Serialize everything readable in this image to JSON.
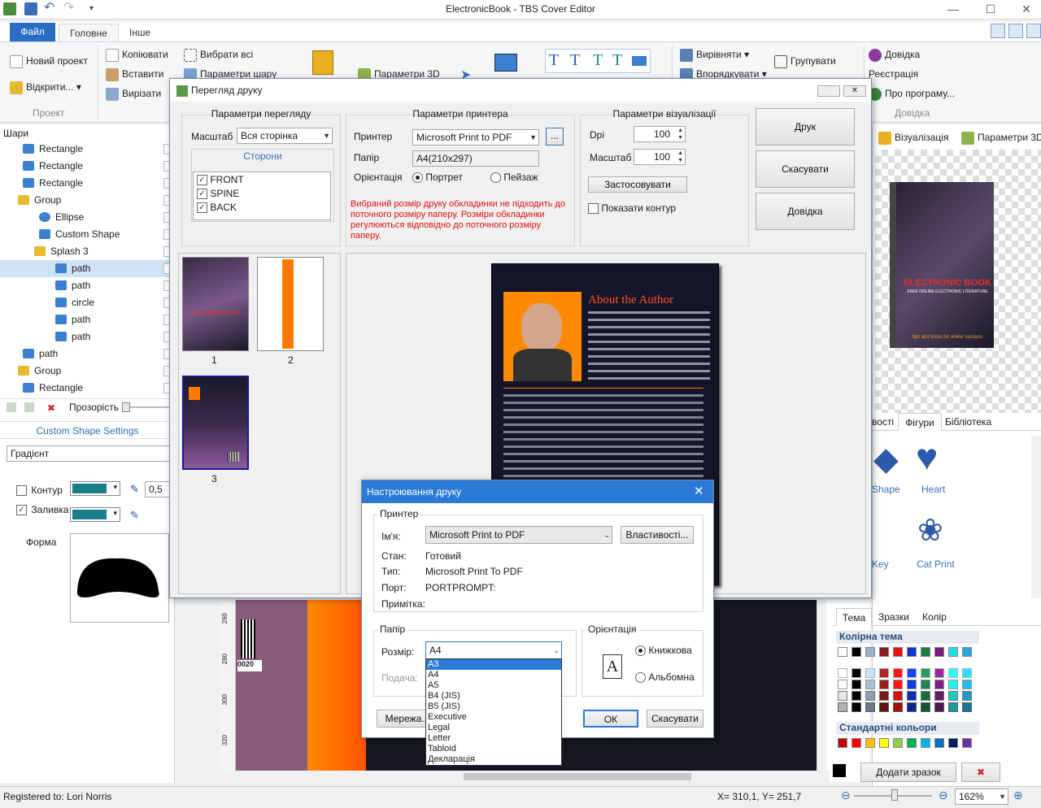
{
  "app": {
    "title": "ElectronicBook - TBS Cover Editor"
  },
  "ribbon": {
    "file_tab": "Файл",
    "tabs": [
      "Головне",
      "Інше"
    ],
    "project": {
      "new": "Новий проект",
      "open": "Відкрити...",
      "label": "Проект"
    },
    "clipboard": {
      "copy": "Копіювати",
      "paste": "Вставити",
      "cut": "Вирізати"
    },
    "select_all": "Вибрати всі",
    "layer_params": "Параметри шару",
    "params3d": "Параметри 3D",
    "arrange": {
      "align": "Вирівняти",
      "order": "Впорядкувати",
      "group": "Групувати"
    },
    "help": {
      "help": "Довідка",
      "register": "Реєстрація",
      "about": "Про програму...",
      "label": "Довідка"
    }
  },
  "layers": {
    "header": "Шари",
    "items": [
      {
        "label": "Rectangle",
        "icon": "rectangle-icon"
      },
      {
        "label": "Rectangle",
        "icon": "rectangle-icon"
      },
      {
        "label": "Rectangle",
        "icon": "rectangle-icon"
      },
      {
        "label": "Group",
        "icon": "folder-icon"
      },
      {
        "label": "Ellipse",
        "icon": "ellipse-icon"
      },
      {
        "label": "Custom Shape",
        "icon": "custom-shape-icon"
      },
      {
        "label": "Splash 3",
        "icon": "folder-icon"
      },
      {
        "label": "path",
        "icon": "path-icon"
      },
      {
        "label": "path",
        "icon": "path-icon"
      },
      {
        "label": "circle",
        "icon": "path-icon"
      },
      {
        "label": "path",
        "icon": "path-icon"
      },
      {
        "label": "path",
        "icon": "path-icon"
      },
      {
        "label": "path",
        "icon": "path-icon"
      },
      {
        "label": "Group",
        "icon": "folder-icon"
      },
      {
        "label": "Rectangle",
        "icon": "rectangle-icon"
      }
    ],
    "transparency_label": "Прозорість",
    "settings_title": "Custom Shape Settings",
    "fill_type": "Градієнт",
    "outline_label": "Контур",
    "outline_width": "0,5",
    "fill_label": "Заливка",
    "shape_label": "Форма"
  },
  "print_preview": {
    "title": "Перегляд друку",
    "view_params": {
      "legend": "Параметри перегляду",
      "scale_label": "Масштаб",
      "scale_value": "Вся сторінка",
      "sides_label": "Сторони",
      "sides": [
        "FRONT",
        "SPINE",
        "BACK"
      ]
    },
    "printer_params": {
      "legend": "Параметри принтера",
      "printer_label": "Принтер",
      "printer_value": "Microsoft Print to PDF",
      "browse": "...",
      "paper_label": "Папір",
      "paper_value": "A4(210x297)",
      "orientation_label": "Орієнтація",
      "portrait": "Портрет",
      "landscape": "Пейзаж",
      "warning": "Вибраний розмір друку обкладинки не підходить до поточного розміру паперу. Розміри обкладинки регулюються відповідно до поточного розміру паперу."
    },
    "visual_params": {
      "legend": "Параметри візуалізації",
      "dpi_label": "Dpi",
      "dpi_value": "100",
      "scale_label": "Масштаб",
      "scale_value": "100",
      "apply": "Застосовувати",
      "show_outline": "Показати контур"
    },
    "buttons": {
      "print": "Друк",
      "cancel": "Скасувати",
      "help": "Довідка"
    },
    "pages": [
      "1",
      "2",
      "3"
    ]
  },
  "cover": {
    "heading": "About the Author",
    "spine_text": "ELECTRONIC BOOK",
    "barcode_num": "0020"
  },
  "print_setup": {
    "title": "Настроювання друку",
    "printer_legend": "Принтер",
    "name_label": "Ім'я:",
    "name_value": "Microsoft Print to PDF",
    "properties": "Властивості...",
    "status_label": "Стан:",
    "status_value": "Готовий",
    "type_label": "Тип:",
    "type_value": "Microsoft Print To PDF",
    "port_label": "Порт:",
    "port_value": "PORTPROMPT:",
    "comment_label": "Примітка:",
    "paper_legend": "Папір",
    "size_label": "Розмір:",
    "size_value": "A4",
    "source_label": "Подача:",
    "size_options": [
      "A3",
      "A4",
      "A5",
      "B4 (JIS)",
      "B5 (JIS)",
      "Executive",
      "Legal",
      "Letter",
      "Tabloid",
      "Декларація"
    ],
    "orientation_legend": "Орієнтація",
    "portrait": "Книжкова",
    "landscape": "Альбомна",
    "network": "Мережа...",
    "ok": "ОК",
    "cancel": "Скасувати"
  },
  "right_panel": {
    "tabs": [
      "Візуалізація",
      "Параметри 3D"
    ],
    "book_title": "ELECTRONIC BOOK",
    "book_subtitle": "FREE ONLINE ELECTRONIC LITERATURE",
    "book_tagline": "tips and tricks for online success",
    "shape_tabs": [
      "вості",
      "Фігури",
      "Бібліотека"
    ],
    "shapes": [
      "Shape",
      "Heart",
      "Key",
      "Cat Print"
    ],
    "color_tabs": [
      "Тема",
      "Зразки",
      "Колір"
    ],
    "theme_colors_label": "Колірна тема",
    "standard_colors_label": "Стандартні кольори",
    "add_sample": "Додати зразок",
    "theme_top": [
      "#ffffff",
      "#000000",
      "#9ab0c8",
      "#8a1b1b",
      "#ee1111",
      "#1133cc",
      "#1a7a4a",
      "#7a1a7a",
      "#22dddd",
      "#22aadd"
    ],
    "standard": [
      "#c00000",
      "#ff0000",
      "#ffc000",
      "#ffff00",
      "#92d050",
      "#00b050",
      "#00b0f0",
      "#0070c0",
      "#002060",
      "#7030a0"
    ]
  },
  "ruler": [
    "260",
    "280",
    "300",
    "320"
  ],
  "status": {
    "registered": "Registered to: Lori Norris",
    "coords": "X= 310,1, Y= 251,7",
    "zoom": "162%"
  }
}
